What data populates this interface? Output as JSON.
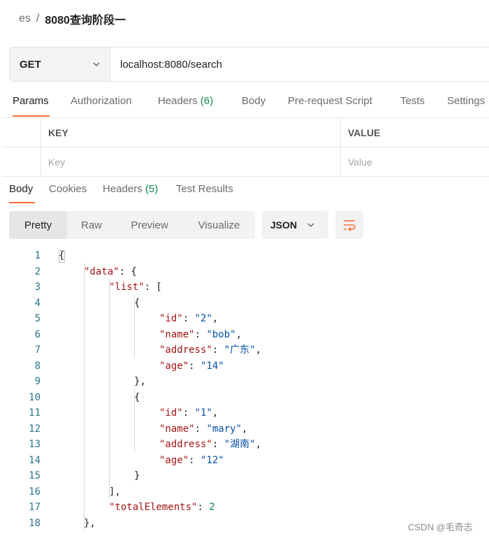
{
  "breadcrumb": {
    "parent": "es",
    "separator": "/",
    "current": "8080查询阶段一"
  },
  "request": {
    "method": "GET",
    "url": "localhost:8080/search",
    "tabs": [
      {
        "label": "Params",
        "count": ""
      },
      {
        "label": "Authorization",
        "count": ""
      },
      {
        "label": "Headers",
        "count": "(6)"
      },
      {
        "label": "Body",
        "count": ""
      },
      {
        "label": "Pre-request Script",
        "count": ""
      },
      {
        "label": "Tests",
        "count": ""
      },
      {
        "label": "Settings",
        "count": ""
      }
    ],
    "active_tab": "Params"
  },
  "params_table": {
    "headers": [
      "KEY",
      "VALUE"
    ],
    "placeholder_key": "Key",
    "placeholder_value": "Value"
  },
  "response": {
    "tabs": [
      {
        "label": "Body",
        "count": ""
      },
      {
        "label": "Cookies",
        "count": ""
      },
      {
        "label": "Headers",
        "count": "(5)"
      },
      {
        "label": "Test Results",
        "count": ""
      }
    ],
    "active_tab": "Body",
    "view_modes": [
      "Pretty",
      "Raw",
      "Preview",
      "Visualize"
    ],
    "active_view": "Pretty",
    "format": "JSON"
  },
  "code_lines": [
    {
      "num": "1",
      "tokens": [
        [
          "p",
          "{"
        ]
      ]
    },
    {
      "num": "2",
      "tokens": [
        [
          "k",
          "\"data\""
        ],
        [
          "p",
          ": {"
        ]
      ]
    },
    {
      "num": "3",
      "tokens": [
        [
          "k",
          "\"list\""
        ],
        [
          "p",
          ": ["
        ]
      ]
    },
    {
      "num": "4",
      "tokens": [
        [
          "p",
          "{"
        ]
      ]
    },
    {
      "num": "5",
      "tokens": [
        [
          "k",
          "\"id\""
        ],
        [
          "p",
          ": "
        ],
        [
          "s",
          "\"2\""
        ],
        [
          "p",
          ","
        ]
      ]
    },
    {
      "num": "6",
      "tokens": [
        [
          "k",
          "\"name\""
        ],
        [
          "p",
          ": "
        ],
        [
          "s",
          "\"bob\""
        ],
        [
          "p",
          ","
        ]
      ]
    },
    {
      "num": "7",
      "tokens": [
        [
          "k",
          "\"address\""
        ],
        [
          "p",
          ": "
        ],
        [
          "s",
          "\"广东\""
        ],
        [
          "p",
          ","
        ]
      ]
    },
    {
      "num": "8",
      "tokens": [
        [
          "k",
          "\"age\""
        ],
        [
          "p",
          ": "
        ],
        [
          "s",
          "\"14\""
        ]
      ]
    },
    {
      "num": "9",
      "tokens": [
        [
          "p",
          "},"
        ]
      ]
    },
    {
      "num": "10",
      "tokens": [
        [
          "p",
          "{"
        ]
      ]
    },
    {
      "num": "11",
      "tokens": [
        [
          "k",
          "\"id\""
        ],
        [
          "p",
          ": "
        ],
        [
          "s",
          "\"1\""
        ],
        [
          "p",
          ","
        ]
      ]
    },
    {
      "num": "12",
      "tokens": [
        [
          "k",
          "\"name\""
        ],
        [
          "p",
          ": "
        ],
        [
          "s",
          "\"mary\""
        ],
        [
          "p",
          ","
        ]
      ]
    },
    {
      "num": "13",
      "tokens": [
        [
          "k",
          "\"address\""
        ],
        [
          "p",
          ": "
        ],
        [
          "s",
          "\"湖南\""
        ],
        [
          "p",
          ","
        ]
      ]
    },
    {
      "num": "14",
      "tokens": [
        [
          "k",
          "\"age\""
        ],
        [
          "p",
          ": "
        ],
        [
          "s",
          "\"12\""
        ]
      ]
    },
    {
      "num": "15",
      "tokens": [
        [
          "p",
          "}"
        ]
      ]
    },
    {
      "num": "16",
      "tokens": [
        [
          "p",
          "],"
        ]
      ]
    },
    {
      "num": "17",
      "tokens": [
        [
          "k",
          "\"totalElements\""
        ],
        [
          "p",
          ": "
        ],
        [
          "n",
          "2"
        ]
      ]
    },
    {
      "num": "18",
      "tokens": [
        [
          "p",
          "},"
        ]
      ]
    }
  ],
  "watermark": "CSDN @毛奇志",
  "icons": {
    "method_dropdown": "chevron-down-icon",
    "format_dropdown": "chevron-down-icon",
    "wrap": "wrap-lines-icon"
  },
  "colors": {
    "accent": "#ff6c37",
    "count_green": "#0f8a4a",
    "json_key": "#a31515",
    "json_string": "#0451a5",
    "json_number": "#098658",
    "line_number": "#2b7489"
  }
}
